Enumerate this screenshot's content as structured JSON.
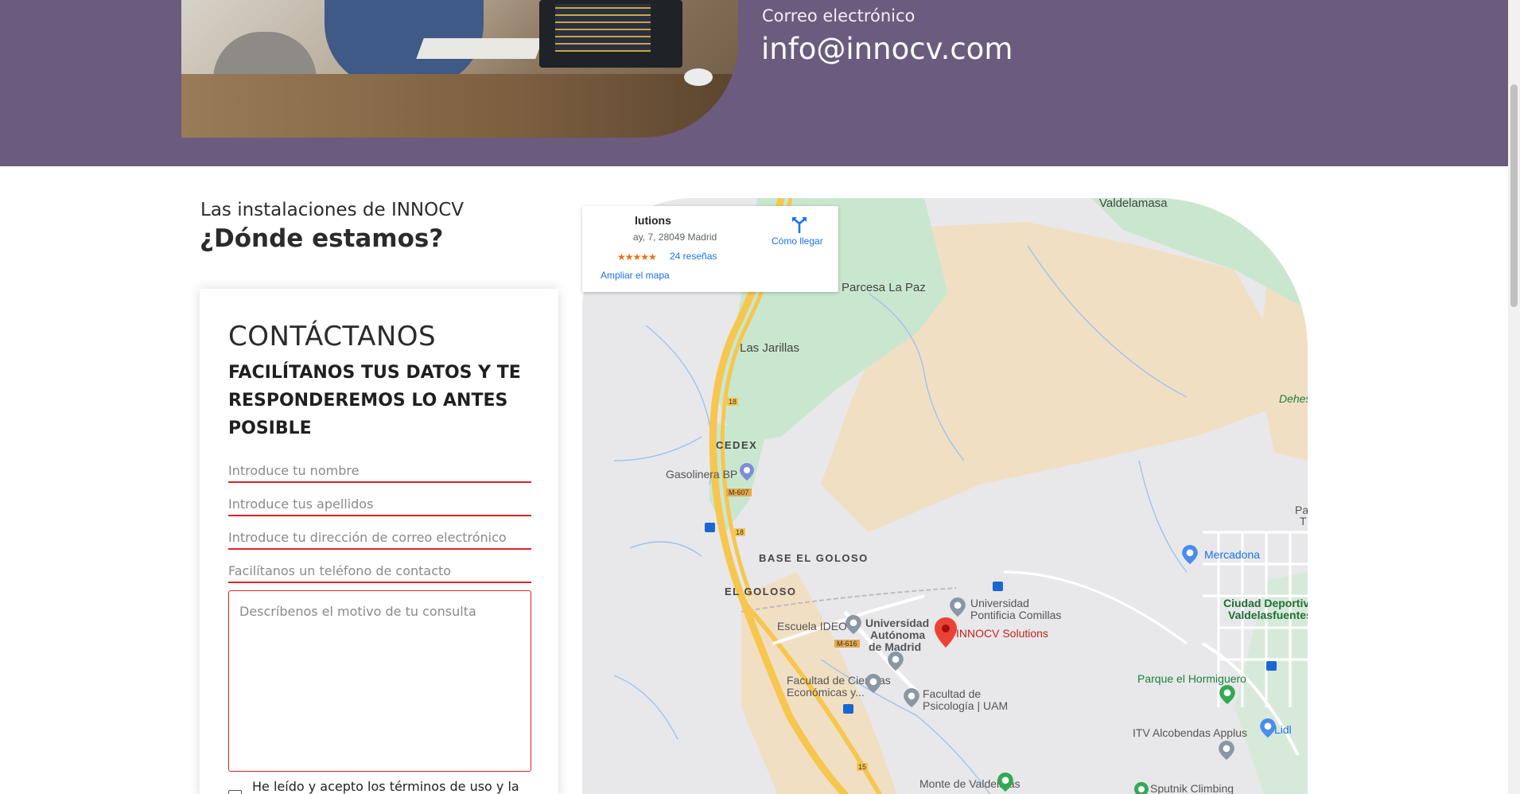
{
  "contact_info": {
    "email_label": "Correo electrónico",
    "email_value": "info@innocv.com"
  },
  "location": {
    "subtitle": "Las instalaciones de INNOCV",
    "title": "¿Dónde estamos?"
  },
  "contact_form": {
    "title": "CONTÁCTANOS",
    "subtitle": "FACILÍTANOS TUS DATOS Y TE RESPONDEREMOS LO ANTES POSIBLE",
    "name_placeholder": "Introduce tu nombre",
    "surname_placeholder": "Introduce tus apellidos",
    "email_placeholder": "Introduce tu dirección de correo electrónico",
    "phone_placeholder": "Facilítanos un teléfono de contacto",
    "message_placeholder": "Descríbenos el motivo de tu consulta",
    "terms_text": "He leído y acepto los términos de uso y la"
  },
  "map": {
    "card": {
      "name": "lutions",
      "address": "ay, 7, 28049 Madrid",
      "stars": "★★★★★",
      "reviews": "24 reseñas",
      "enlarge": "Ampliar el mapa",
      "directions": "Cómo llegar"
    },
    "labels": {
      "valdelamasa": "Valdelamasa",
      "parcesa": "Parcesa La Paz",
      "las_jarillas": "Las Jarillas",
      "dehesa": "Dehes",
      "cedex": "CEDEX",
      "gasolinera": "Gasolinera BP",
      "base_goloso": "BASE EL GOLOSO",
      "el_goloso": "EL GOLOSO",
      "mercadona": "Mercadona",
      "pa": "Pa",
      "t": "T",
      "upc_1": "Universidad",
      "upc_2": "Pontificia Comillas",
      "ciudad_dep_1": "Ciudad Deportiva",
      "ciudad_dep_2": "Valdelasfuentes",
      "escuela_ideo": "Escuela IDEO",
      "uam_1": "Universidad",
      "uam_2": "Autónoma",
      "uam_3": "de Madrid",
      "innocv": "INNOCV Solutions",
      "parque_hormiguero": "Parque el Hormiguero",
      "fac_ciencias_1": "Facultad de Ciencias",
      "fac_ciencias_2": "Económicas y...",
      "fac_psico_1": "Facultad de",
      "fac_psico_2": "Psicología | UAM",
      "itv": "ITV Alcobendas Applus",
      "lidl": "Lidl",
      "monte": "Monte de Valdelatas",
      "sputnik": "Sputnik Climbing",
      "road_18a": "18",
      "road_18b": "18",
      "road_m607": "M-607",
      "road_m616": "M-616",
      "road_15": "15"
    }
  },
  "colors": {
    "purple_band": "#6b5b7e",
    "accent_red": "#d8232a",
    "map_pin": "#ea4335",
    "link_blue": "#1a73e8"
  }
}
